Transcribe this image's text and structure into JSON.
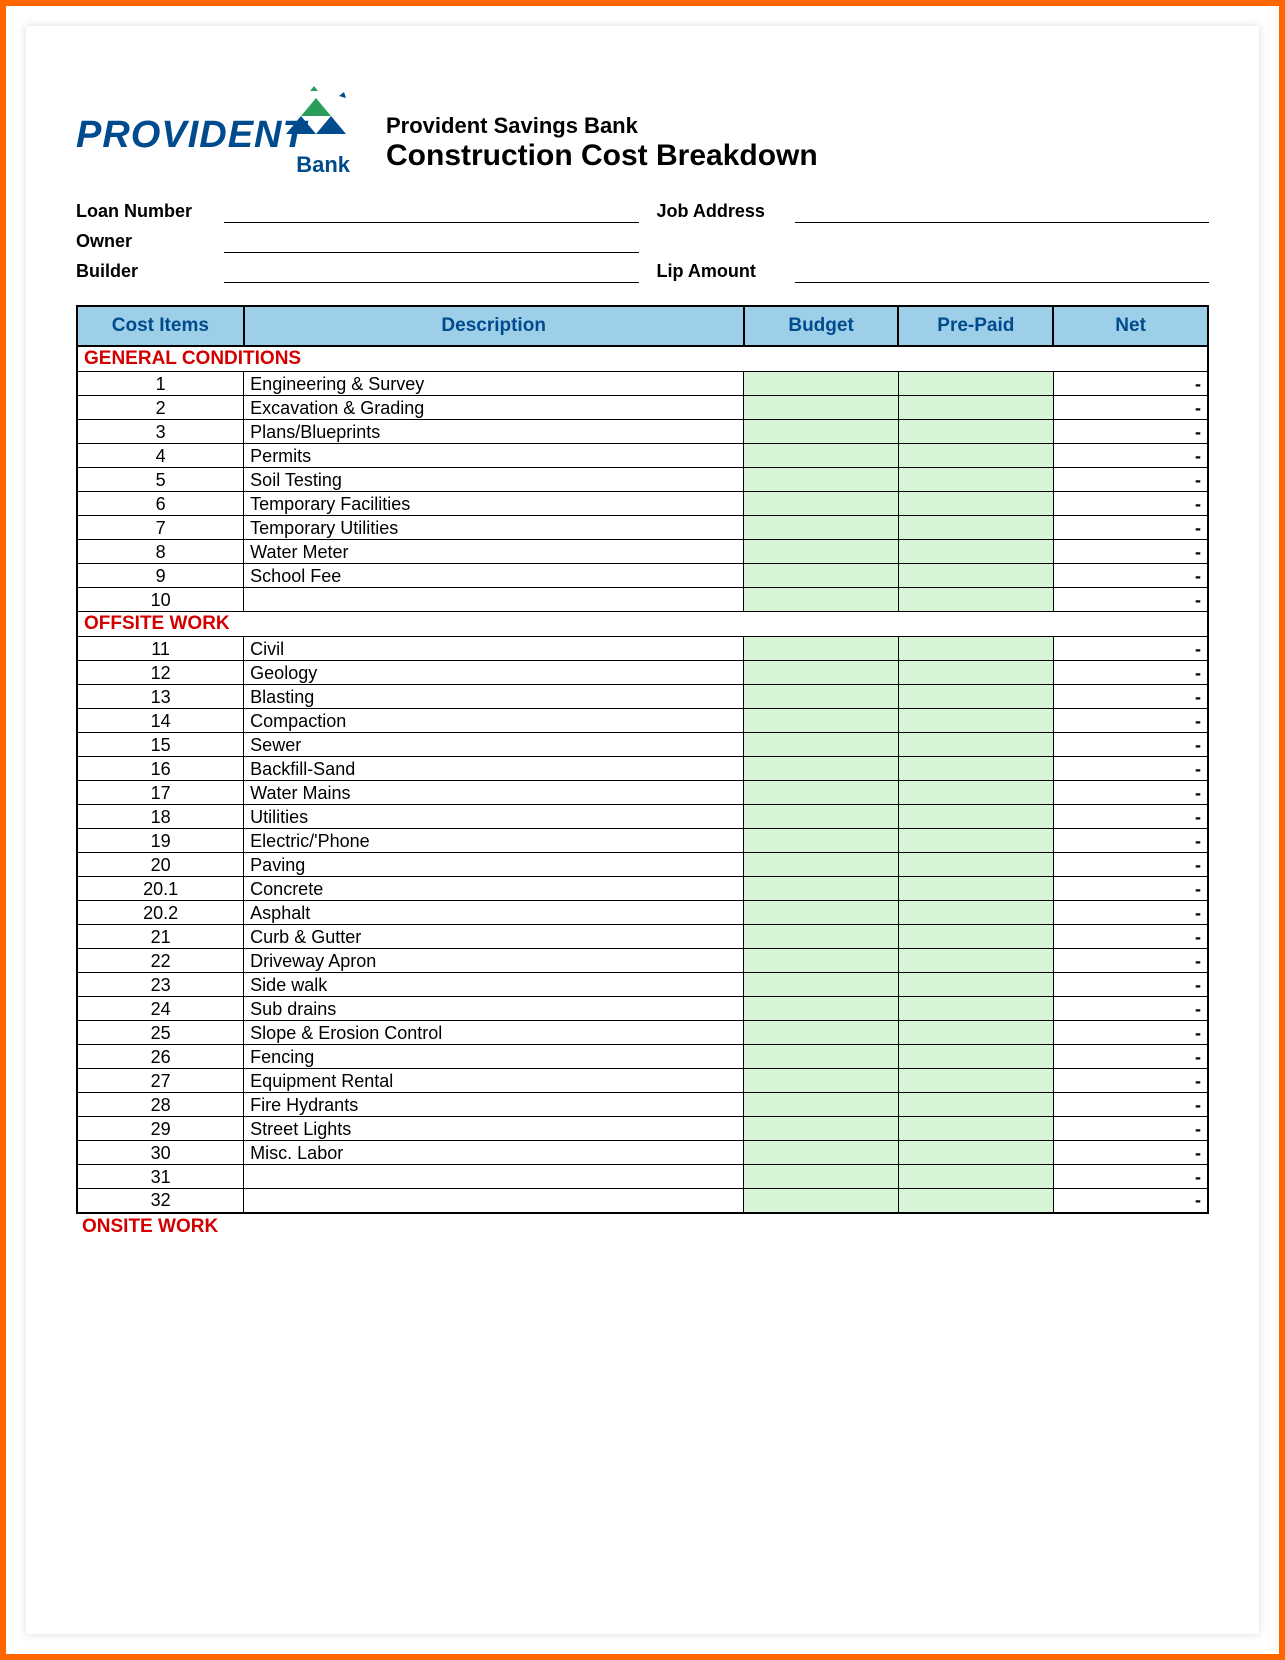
{
  "header": {
    "logo_main": "PROVIDENT",
    "logo_sub": "Bank",
    "org": "Provident Savings Bank",
    "title": "Construction Cost Breakdown"
  },
  "form": {
    "loan_number": "Loan Number",
    "job_address": "Job Address",
    "owner": "Owner",
    "builder": "Builder",
    "lip_amount": "Lip Amount"
  },
  "columns": {
    "cost_items": "Cost  Items",
    "description": "Description",
    "budget": "Budget",
    "prepaid": "Pre-Paid",
    "net": "Net"
  },
  "sections": [
    {
      "title": "GENERAL CONDITIONS",
      "rows": [
        {
          "n": "1",
          "d": "Engineering & Survey",
          "net": "-"
        },
        {
          "n": "2",
          "d": "Excavation & Grading",
          "net": "-"
        },
        {
          "n": "3",
          "d": "Plans/Blueprints",
          "net": "-"
        },
        {
          "n": "4",
          "d": "Permits",
          "net": "-"
        },
        {
          "n": "5",
          "d": "Soil Testing",
          "net": "-"
        },
        {
          "n": "6",
          "d": "Temporary Facilities",
          "net": "-"
        },
        {
          "n": "7",
          "d": "Temporary Utilities",
          "net": "-"
        },
        {
          "n": "8",
          "d": "Water Meter",
          "net": "-"
        },
        {
          "n": "9",
          "d": "School Fee",
          "net": "-"
        },
        {
          "n": "10",
          "d": "",
          "net": "-"
        }
      ]
    },
    {
      "title": "OFFSITE WORK",
      "rows": [
        {
          "n": "11",
          "d": "Civil",
          "net": "-"
        },
        {
          "n": "12",
          "d": "Geology",
          "net": "-"
        },
        {
          "n": "13",
          "d": "Blasting",
          "net": "-"
        },
        {
          "n": "14",
          "d": "Compaction",
          "net": "-"
        },
        {
          "n": "15",
          "d": "Sewer",
          "net": "-"
        },
        {
          "n": "16",
          "d": "Backfill-Sand",
          "net": "-"
        },
        {
          "n": "17",
          "d": "Water Mains",
          "net": "-"
        },
        {
          "n": "18",
          "d": "Utilities",
          "net": "-"
        },
        {
          "n": "19",
          "d": "Electric/'Phone",
          "net": "-"
        },
        {
          "n": "20",
          "d": "Paving",
          "net": "-"
        },
        {
          "n": "20.1",
          "d": "Concrete",
          "net": "-"
        },
        {
          "n": "20.2",
          "d": "Asphalt",
          "net": "-"
        },
        {
          "n": "21",
          "d": "Curb & Gutter",
          "net": "-"
        },
        {
          "n": "22",
          "d": "Driveway Apron",
          "net": "-"
        },
        {
          "n": "23",
          "d": "Side walk",
          "net": "-"
        },
        {
          "n": "24",
          "d": "Sub drains",
          "net": "-"
        },
        {
          "n": "25",
          "d": "Slope & Erosion Control",
          "net": "-"
        },
        {
          "n": "26",
          "d": "Fencing",
          "net": "-"
        },
        {
          "n": "27",
          "d": "Equipment Rental",
          "net": "-"
        },
        {
          "n": "28",
          "d": "Fire Hydrants",
          "net": "-"
        },
        {
          "n": "29",
          "d": "Street Lights",
          "net": "-"
        },
        {
          "n": "30",
          "d": "Misc. Labor",
          "net": "-"
        },
        {
          "n": "31",
          "d": "",
          "net": "-"
        },
        {
          "n": "32",
          "d": "",
          "net": "-"
        }
      ]
    }
  ],
  "trailing_section": "ONSITE WORK"
}
